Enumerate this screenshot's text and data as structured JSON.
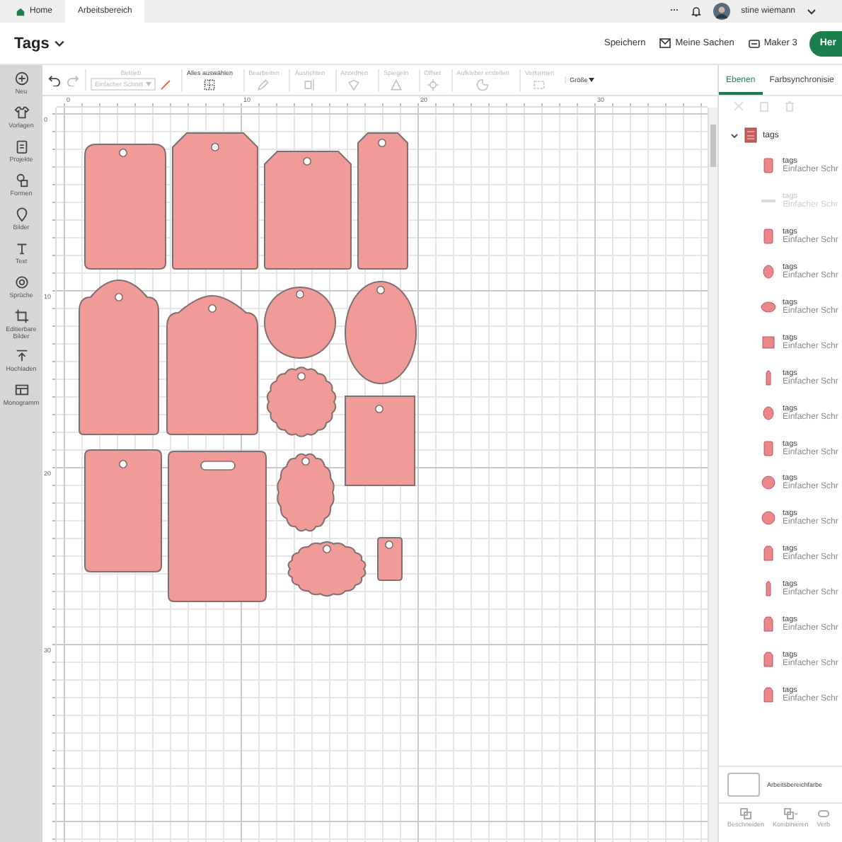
{
  "top_bar": {
    "tabs": [
      {
        "label": "Home",
        "selected": false
      },
      {
        "label": "Arbeitsbereich",
        "selected": true
      }
    ],
    "more": "···",
    "user": "stine wiemann"
  },
  "header": {
    "title": "Tags",
    "actions": [
      {
        "kind": "text",
        "label": "Speichern"
      },
      {
        "kind": "mail",
        "label": "Meine Sachen"
      },
      {
        "kind": "machine",
        "label": "Maker 3"
      }
    ],
    "primary": "Her"
  },
  "sidebar": [
    {
      "kind": "plus",
      "label": "Neu"
    },
    {
      "kind": "shirt",
      "label": "Vorlagen"
    },
    {
      "kind": "clipboard",
      "label": "Projekte"
    },
    {
      "kind": "shapes",
      "label": "Formen"
    },
    {
      "kind": "pin",
      "label": "Bilder"
    },
    {
      "kind": "text",
      "label": "Text"
    },
    {
      "kind": "bubble",
      "label": "Sprüche"
    },
    {
      "kind": "crop",
      "label": "Editierbare Bilder"
    },
    {
      "kind": "upload",
      "label": "Hochladen"
    },
    {
      "kind": "grid",
      "label": "Monogramm"
    }
  ],
  "toolbar": [
    {
      "kind": "select",
      "label": "Betrieb",
      "value": "Einfacher Schnitt",
      "disabled": true
    },
    {
      "kind": "select-all",
      "label": "Alles auswählen",
      "disabled": false
    },
    {
      "kind": "pencil",
      "label": "Bearbeiten",
      "disabled": true
    },
    {
      "kind": "align",
      "label": "Ausrichten",
      "disabled": true
    },
    {
      "kind": "arrange",
      "label": "Anordnen",
      "disabled": true
    },
    {
      "kind": "mirror",
      "label": "Spiegeln",
      "disabled": true
    },
    {
      "kind": "offset",
      "label": "Offset",
      "disabled": true
    },
    {
      "kind": "sticker",
      "label": "Aufkleber erstellen",
      "disabled": true
    },
    {
      "kind": "warp",
      "label": "Verformen",
      "disabled": true
    },
    {
      "kind": "size",
      "label": "Größe",
      "disabled": false
    }
  ],
  "ruler": {
    "x_labels": [
      "0",
      "10",
      "20",
      "30"
    ],
    "y_labels": [
      "0",
      "10",
      "20",
      "30"
    ]
  },
  "panel": {
    "tabs": [
      {
        "label": "Ebenen",
        "selected": true
      },
      {
        "label": "Farbsynchronisie",
        "selected": false
      }
    ],
    "group": {
      "name": "tags",
      "expanded": true,
      "children": [
        {
          "name": "tags",
          "operation": "Einfacher Schr",
          "kind": "rect",
          "visible": true
        },
        {
          "name": "tags",
          "operation": "Einfacher Schr",
          "kind": "slot",
          "visible": false
        },
        {
          "name": "tags",
          "operation": "Einfacher Schr",
          "kind": "rect",
          "visible": true
        },
        {
          "name": "tags",
          "operation": "Einfacher Schr",
          "kind": "ellipse",
          "visible": true
        },
        {
          "name": "tags",
          "operation": "Einfacher Schr",
          "kind": "oval",
          "visible": true
        },
        {
          "name": "tags",
          "operation": "Einfacher Schr",
          "kind": "square",
          "visible": true
        },
        {
          "name": "tags",
          "operation": "Einfacher Schr",
          "kind": "narrow",
          "visible": true
        },
        {
          "name": "tags",
          "operation": "Einfacher Schr",
          "kind": "ellipse",
          "visible": true
        },
        {
          "name": "tags",
          "operation": "Einfacher Schr",
          "kind": "rect",
          "visible": true
        },
        {
          "name": "tags",
          "operation": "Einfacher Schr",
          "kind": "circle",
          "visible": true
        },
        {
          "name": "tags",
          "operation": "Einfacher Schr",
          "kind": "circle",
          "visible": true
        },
        {
          "name": "tags",
          "operation": "Einfacher Schr",
          "kind": "tag",
          "visible": true
        },
        {
          "name": "tags",
          "operation": "Einfacher Schr",
          "kind": "narrow",
          "visible": true
        },
        {
          "name": "tags",
          "operation": "Einfacher Schr",
          "kind": "tag",
          "visible": true
        },
        {
          "name": "tags",
          "operation": "Einfacher Schr",
          "kind": "tag",
          "visible": true
        },
        {
          "name": "tags",
          "operation": "Einfacher Schr",
          "kind": "tag",
          "visible": true
        }
      ]
    },
    "canvas_color_label": "Arbeitsbereichfarbe",
    "bottom_actions": [
      {
        "kind": "slice",
        "label": "Beschneiden"
      },
      {
        "kind": "combine",
        "label": "Kombinieren"
      },
      {
        "kind": "link",
        "label": "Verb"
      }
    ]
  }
}
